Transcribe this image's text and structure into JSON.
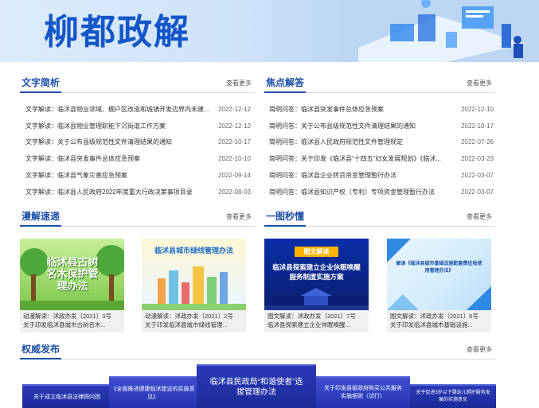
{
  "banner": {
    "title": "柳都政解"
  },
  "sections": {
    "text_brief": {
      "title": "文字简析",
      "more": "查看更多"
    },
    "focus": {
      "title": "焦点解答",
      "more": "查看更多"
    },
    "comic": {
      "title": "漫解速递",
      "more": "查看更多"
    },
    "onepic": {
      "title": "一图秒懂",
      "more": "查看更多"
    },
    "authority": {
      "title": "权威发布",
      "more": "查看更多"
    }
  },
  "text_brief_items": [
    {
      "title": "文字解读：临沭县物业领域、棚户区改造和城镇开发边界内未建...",
      "date": "2022-12-12"
    },
    {
      "title": "文字解读：临沭县物业管理职能下沉街道工作方案",
      "date": "2022-12-12"
    },
    {
      "title": "文字解读：关于公布县级规范性文件清理结果的通知",
      "date": "2022-10-17"
    },
    {
      "title": "文字解读：临沭县突发事件总体应急预案",
      "date": "2022-10-10"
    },
    {
      "title": "文字解读：临沭县气象灾害应急预案",
      "date": "2022-09-14"
    },
    {
      "title": "文字解读：临沭县人民政府2022年度重大行政决策事项目录",
      "date": "2022-08-03"
    }
  ],
  "focus_items": [
    {
      "title": "简明问答：临沭县突发事件总体应急预案",
      "date": "2022-12-10"
    },
    {
      "title": "简明问答：关于公布县级规范性文件清理结果的通知",
      "date": "2022-10-17"
    },
    {
      "title": "简明问答：临沭县人民政府规范性文件管理规定",
      "date": "2022-07-26"
    },
    {
      "title": "简明问答：关于印发《临沭县“十四五”妇女发展规划》《临沭...",
      "date": "2022-03-23"
    },
    {
      "title": "简明问答：临沭县企业转贷资金管理暂行办法",
      "date": "2022-03-07"
    },
    {
      "title": "简明问答：临沭县知识产权（专利）专项资金管理暂行办法",
      "date": "2022-03-07"
    }
  ],
  "cards": [
    {
      "thumb": "临沭县古树名木保护管理办法",
      "line1": "动漫解读：沭政办发〔2021〕3号",
      "line2": "关于印发临沭县城市古树名木..."
    },
    {
      "thumb": "临沭县城市绿线管理办法",
      "line1": "动漫解读：沭政办发〔2021〕2号",
      "line2": "关于印发临沭县城市绿线管理..."
    },
    {
      "thumb_tag": "图文解读",
      "thumb": "临沭县探索建立企业休眠唤醒服务制度实施方案",
      "line1": "图文解读：沭政办发〔2021〕7号",
      "line2": "临沭县探索建立企业休眠唤醒..."
    },
    {
      "thumb": "解读《临沭县城市基础设施配套费征收使用管理办法》",
      "line1": "图文解读：沭政办发〔2021〕6号",
      "line2": "关于印发临沭县城市基础设施..."
    }
  ],
  "strip": [
    {
      "label": "关于成立临沭县法律顾问团"
    },
    {
      "label": "《全面推进健康临沭建设的实施意见》"
    },
    {
      "label": "临沭县民政局“和谐使者”选拔管理办法"
    },
    {
      "label": "关于印发县级政府购买公共服务实施细则（试行）"
    },
    {
      "label": "关于促进3岁以下婴幼儿照护服务发展的实施意见"
    }
  ],
  "colors": {
    "brand_blue": "#1356c8",
    "section_blue": "#1e4fa8",
    "strip_blue": "#1d2a9a"
  }
}
